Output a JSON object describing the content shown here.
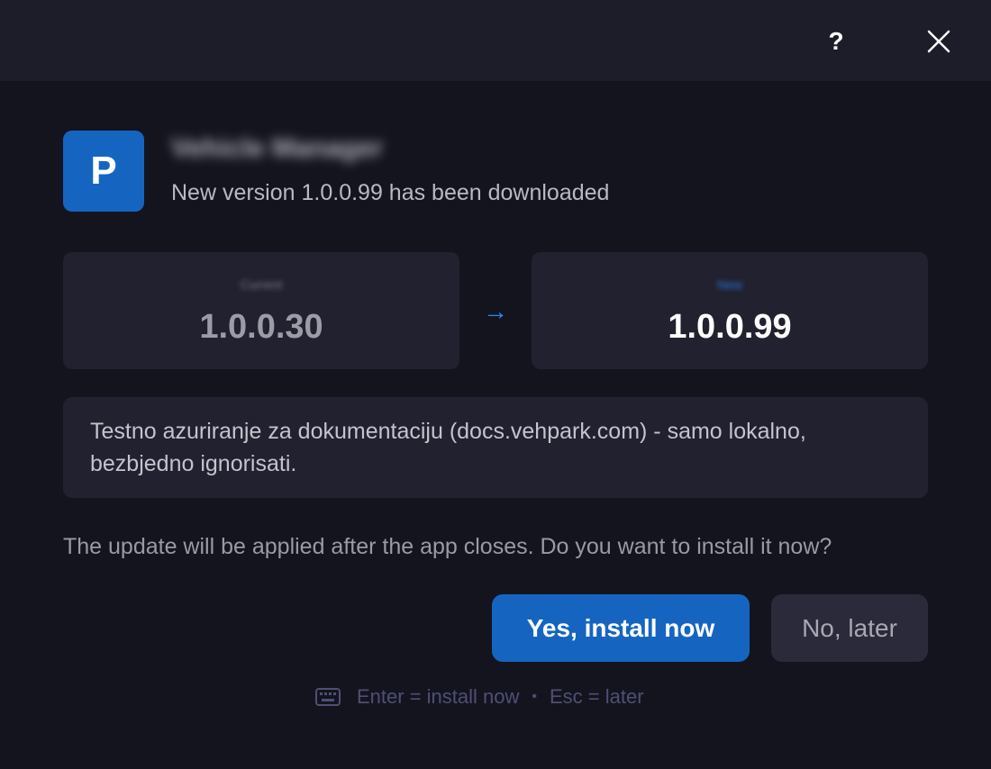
{
  "titlebar": {
    "help_label": "?",
    "close_icon": "close-icon"
  },
  "app": {
    "icon_letter": "P",
    "name_redacted": "Vehicle Manager",
    "subtitle": "New version 1.0.0.99 has been downloaded"
  },
  "versions": {
    "current": {
      "label_redacted": "Current",
      "number": "1.0.0.30"
    },
    "arrow": "→",
    "new": {
      "label_redacted": "New",
      "number": "1.0.0.99"
    }
  },
  "notes": "Testno azuriranje za dokumentaciju (docs.vehpark.com) - samo lokalno, bezbjedno ignorisati.",
  "question": "The update will be applied after the app closes. Do you want to install it now?",
  "buttons": {
    "yes": "Yes, install now",
    "no": "No, later"
  },
  "hint": {
    "icon": "keyboard-icon",
    "enter": "Enter = install now",
    "separator": "•",
    "esc": "Esc = later"
  },
  "colors": {
    "accent": "#1565c0",
    "arrow": "#2f86f0",
    "background": "#14141f",
    "card": "#21212f"
  }
}
